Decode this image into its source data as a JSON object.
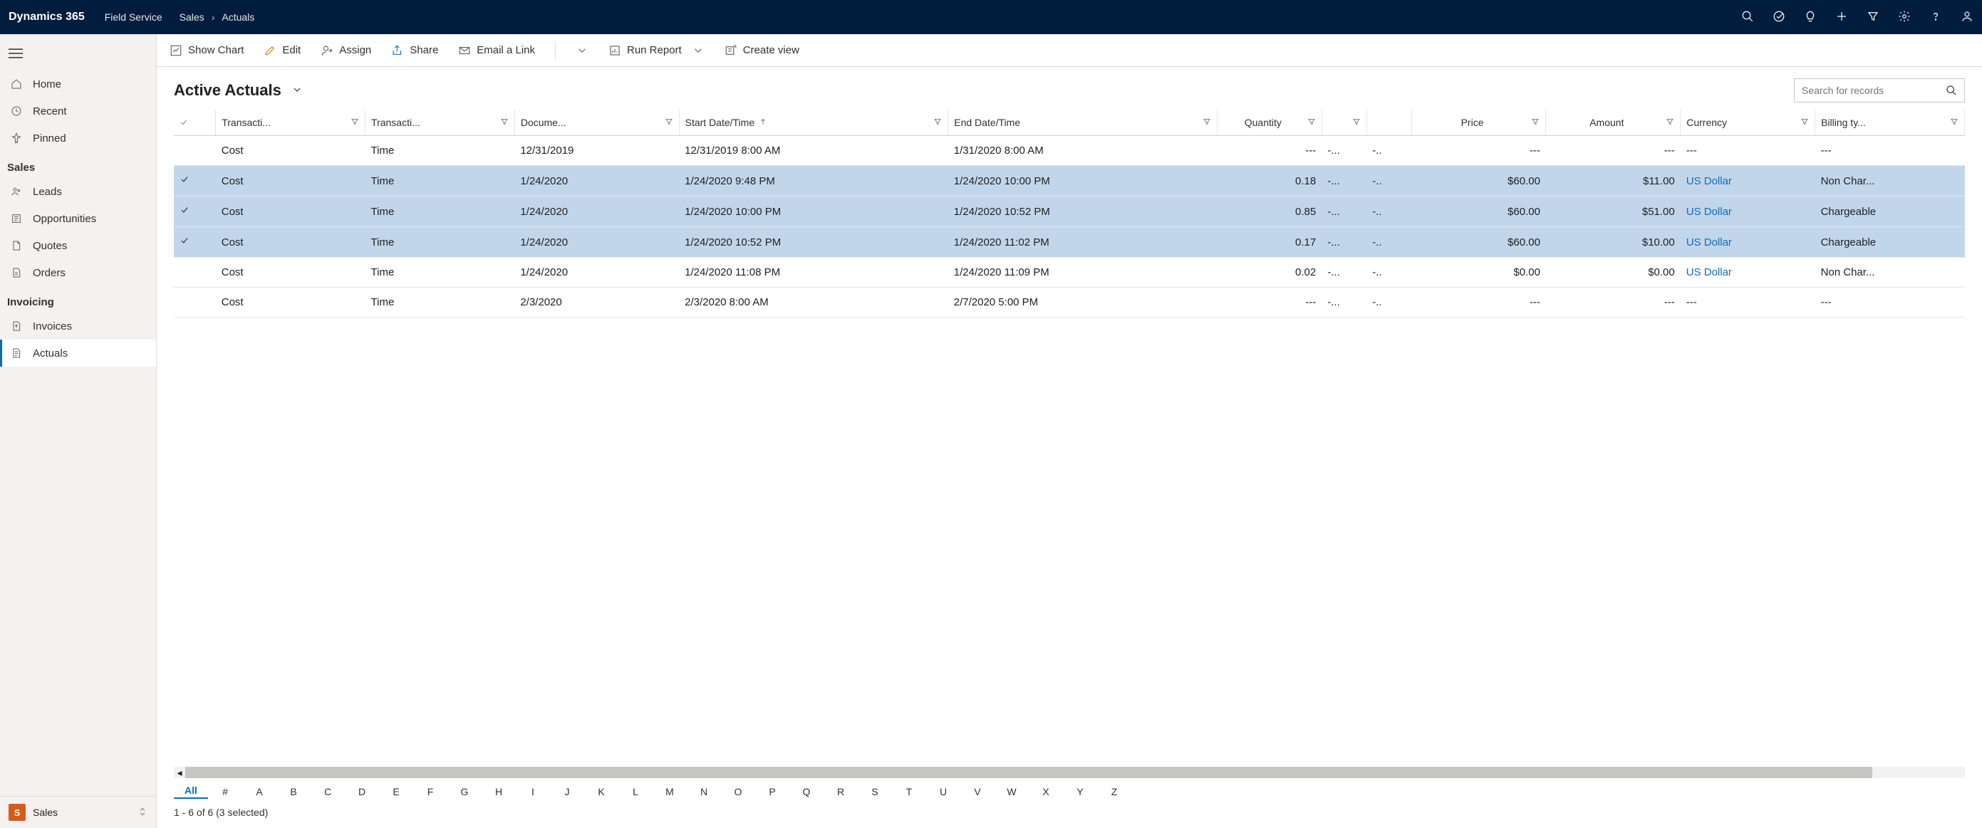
{
  "topbar": {
    "brand": "Dynamics 365",
    "app": "Field Service",
    "crumb1": "Sales",
    "crumb2": "Actuals"
  },
  "sidebar": {
    "home": "Home",
    "recent": "Recent",
    "pinned": "Pinned",
    "sections": [
      {
        "title": "Sales",
        "items": [
          "Leads",
          "Opportunities",
          "Quotes",
          "Orders"
        ]
      },
      {
        "title": "Invoicing",
        "items": [
          "Invoices",
          "Actuals"
        ],
        "activeIndex": 1
      }
    ],
    "bottom": {
      "tile": "S",
      "label": "Sales"
    }
  },
  "cmdbar": {
    "showChart": "Show Chart",
    "edit": "Edit",
    "assign": "Assign",
    "share": "Share",
    "emailLink": "Email a Link",
    "runReport": "Run Report",
    "createView": "Create view"
  },
  "view": {
    "title": "Active Actuals",
    "searchPlaceholder": "Search for records"
  },
  "columns": {
    "transactionType": "Transacti...",
    "transactionClass": "Transacti...",
    "documentDate": "Docume...",
    "startDate": "Start Date/Time",
    "endDate": "End Date/Time",
    "quantity": "Quantity",
    "price": "Price",
    "amount": "Amount",
    "currency": "Currency",
    "billingType": "Billing ty..."
  },
  "rows": [
    {
      "selected": false,
      "type": "Cost",
      "class": "Time",
      "doc": "12/31/2019",
      "start": "12/31/2019 8:00 AM",
      "end": "1/31/2020 8:00 AM",
      "qty": "---",
      "u1": "-...",
      "u2": "-..",
      "price": "---",
      "amount": "---",
      "currency": "---",
      "billing": "---",
      "curLink": false
    },
    {
      "selected": true,
      "type": "Cost",
      "class": "Time",
      "doc": "1/24/2020",
      "start": "1/24/2020 9:48 PM",
      "end": "1/24/2020 10:00 PM",
      "qty": "0.18",
      "u1": "-...",
      "u2": "-..",
      "price": "$60.00",
      "amount": "$11.00",
      "currency": "US Dollar",
      "billing": "Non Char...",
      "curLink": true
    },
    {
      "selected": true,
      "type": "Cost",
      "class": "Time",
      "doc": "1/24/2020",
      "start": "1/24/2020 10:00 PM",
      "end": "1/24/2020 10:52 PM",
      "qty": "0.85",
      "u1": "-...",
      "u2": "-..",
      "price": "$60.00",
      "amount": "$51.00",
      "currency": "US Dollar",
      "billing": "Chargeable",
      "curLink": true
    },
    {
      "selected": true,
      "type": "Cost",
      "class": "Time",
      "doc": "1/24/2020",
      "start": "1/24/2020 10:52 PM",
      "end": "1/24/2020 11:02 PM",
      "qty": "0.17",
      "u1": "-...",
      "u2": "-..",
      "price": "$60.00",
      "amount": "$10.00",
      "currency": "US Dollar",
      "billing": "Chargeable",
      "curLink": true
    },
    {
      "selected": false,
      "type": "Cost",
      "class": "Time",
      "doc": "1/24/2020",
      "start": "1/24/2020 11:08 PM",
      "end": "1/24/2020 11:09 PM",
      "qty": "0.02",
      "u1": "-...",
      "u2": "-..",
      "price": "$0.00",
      "amount": "$0.00",
      "currency": "US Dollar",
      "billing": "Non Char...",
      "curLink": true
    },
    {
      "selected": false,
      "type": "Cost",
      "class": "Time",
      "doc": "2/3/2020",
      "start": "2/3/2020 8:00 AM",
      "end": "2/7/2020 5:00 PM",
      "qty": "---",
      "u1": "-...",
      "u2": "-..",
      "price": "---",
      "amount": "---",
      "currency": "---",
      "billing": "---",
      "curLink": false
    }
  ],
  "alphabar": [
    "All",
    "#",
    "A",
    "B",
    "C",
    "D",
    "E",
    "F",
    "G",
    "H",
    "I",
    "J",
    "K",
    "L",
    "M",
    "N",
    "O",
    "P",
    "Q",
    "R",
    "S",
    "T",
    "U",
    "V",
    "W",
    "X",
    "Y",
    "Z"
  ],
  "status": "1 - 6 of 6 (3 selected)"
}
